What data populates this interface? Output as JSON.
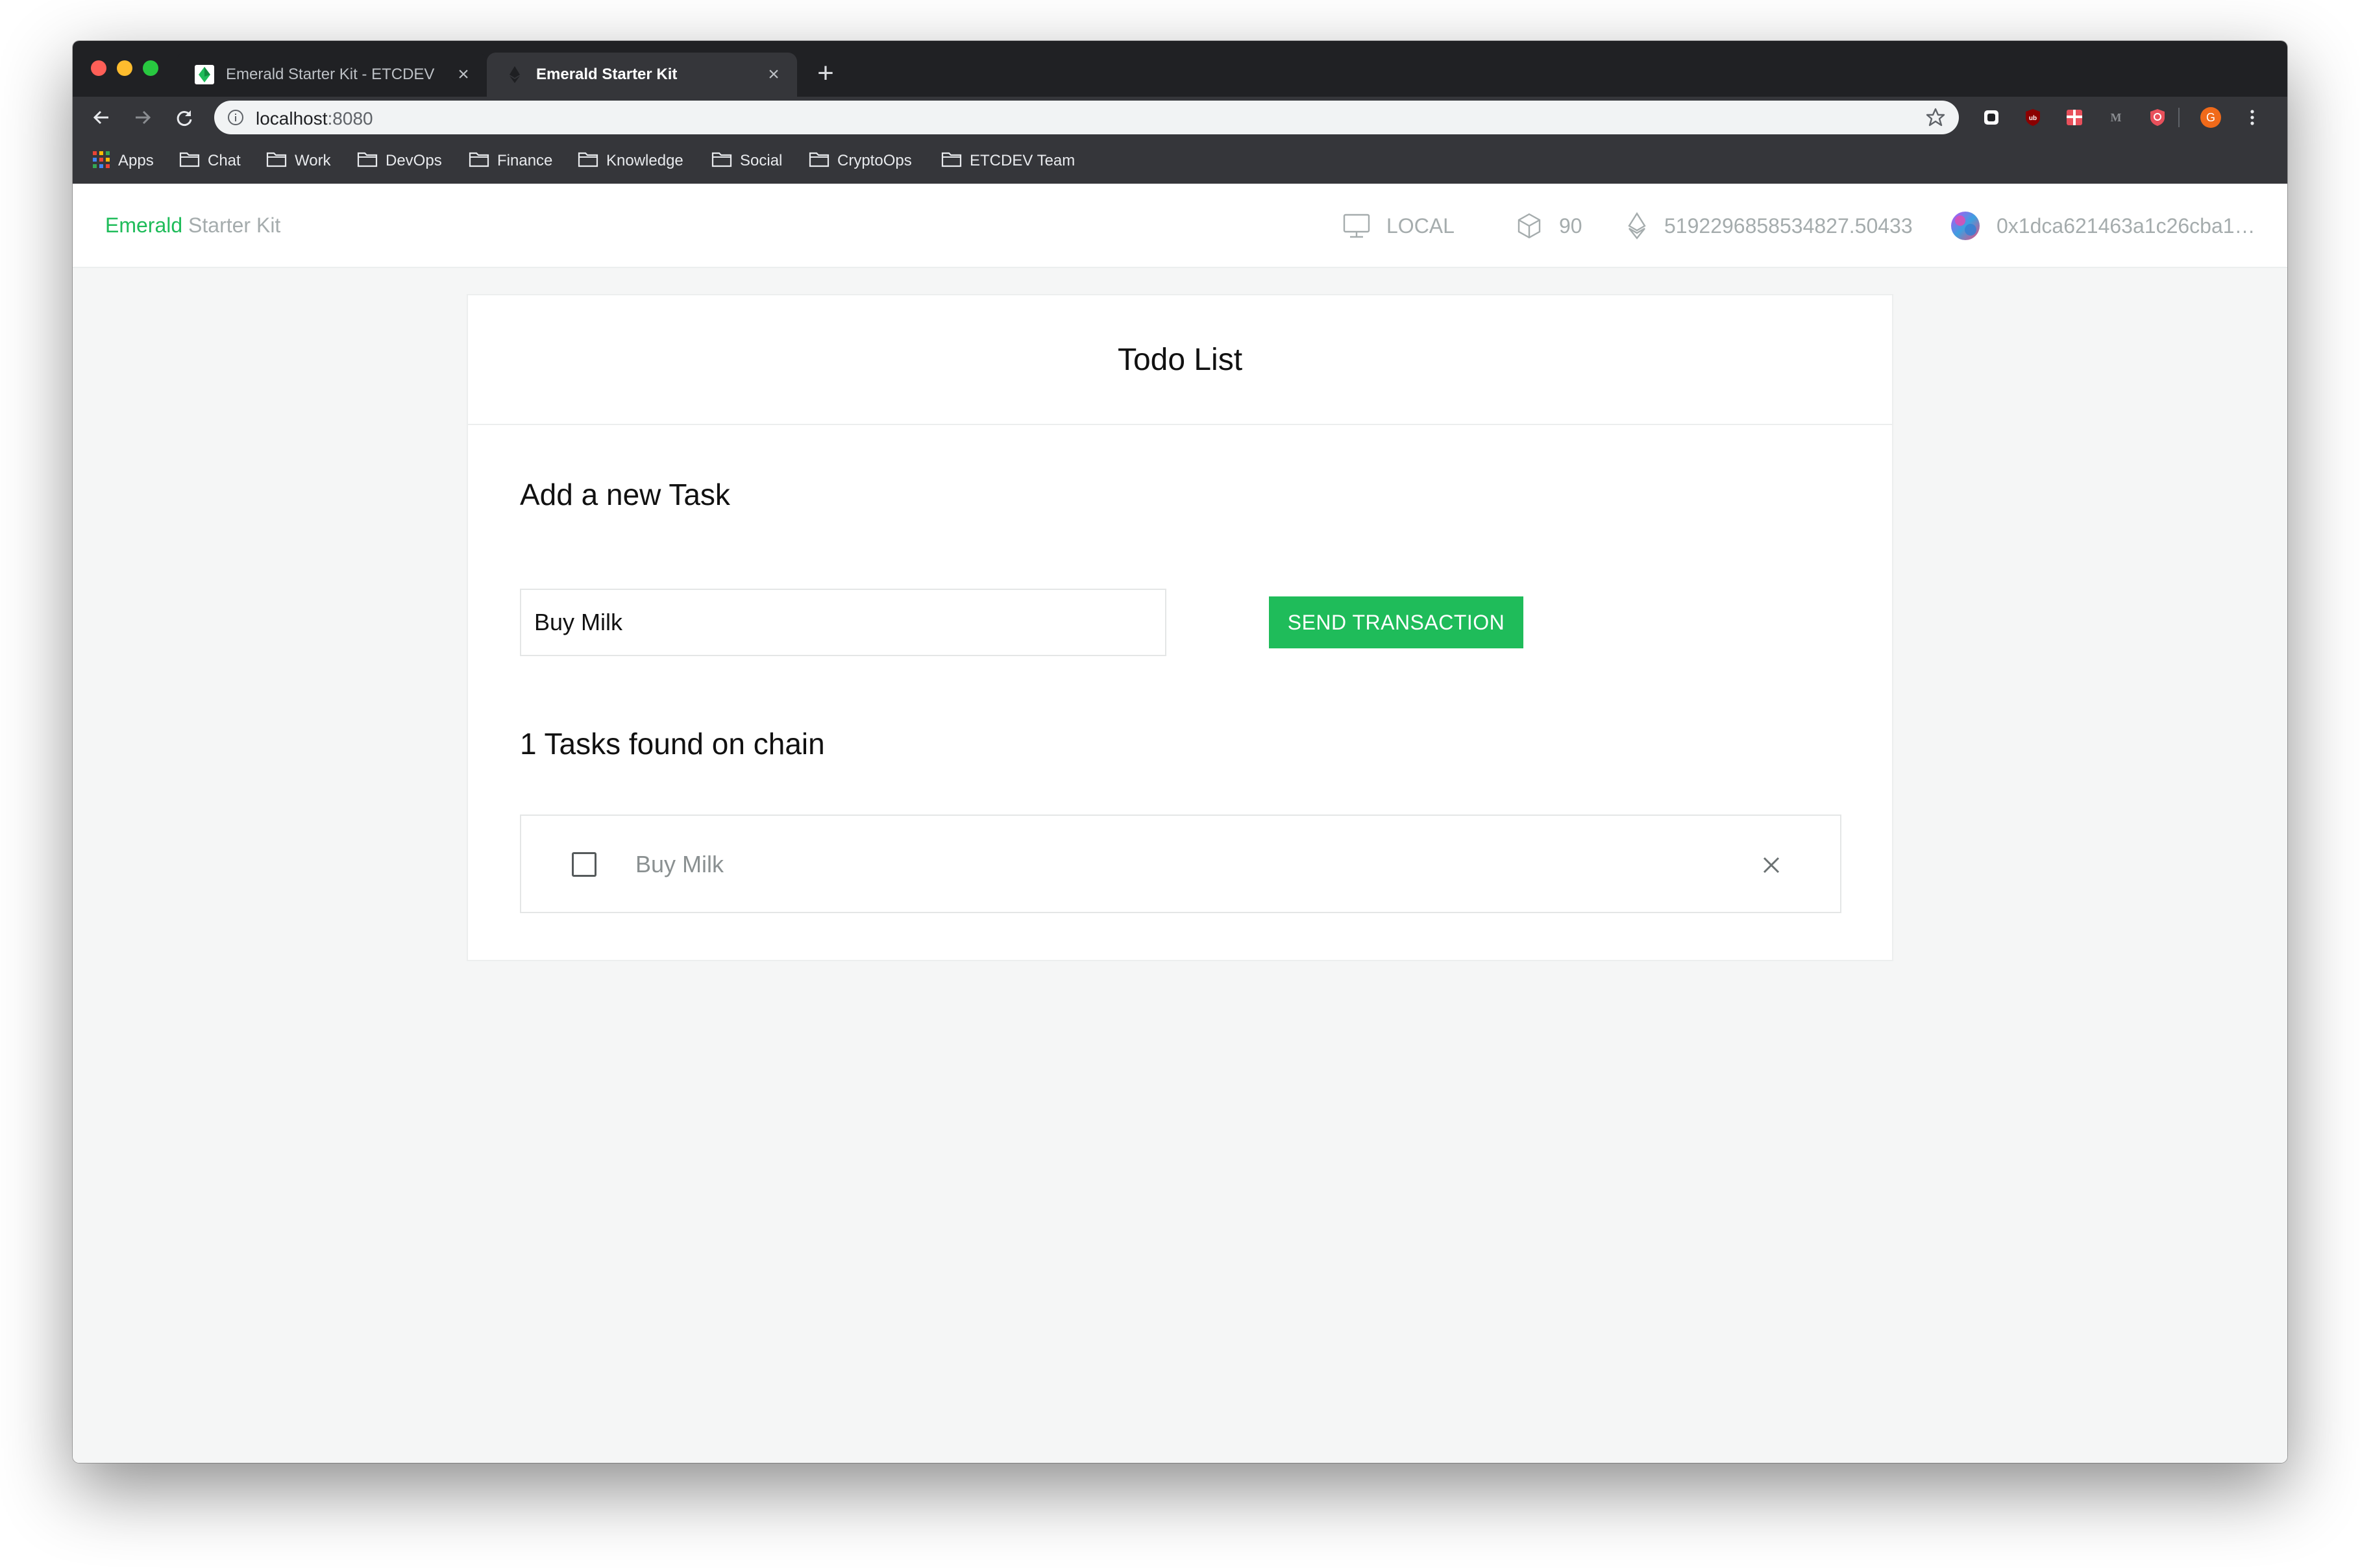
{
  "browser": {
    "tabs": [
      {
        "title": "Emerald Starter Kit - ETCDEV",
        "active": false
      },
      {
        "title": "Emerald Starter Kit",
        "active": true
      }
    ],
    "new_tab_symbol": "+",
    "tab_close_symbol": "×",
    "address": {
      "host": "localhost",
      "port": ":8080"
    },
    "bookmarks": [
      "Apps",
      "Chat",
      "Work",
      "DevOps",
      "Finance",
      "Knowledge",
      "Social",
      "CryptoOps",
      "ETCDEV Team"
    ],
    "profile_initial": "G",
    "extension_m_label": "M",
    "extension_ub_label": "ub"
  },
  "app": {
    "brand_primary": "Emerald",
    "brand_secondary": "Starter Kit",
    "network": "LOCAL",
    "block_number": "90",
    "balance": "5192296858534827.50433",
    "address": "0x1dca621463a1c26cba1…"
  },
  "todo": {
    "title": "Todo List",
    "add_heading": "Add a new Task",
    "input_value": "Buy Milk",
    "send_button": "SEND TRANSACTION",
    "found_heading": "1 Tasks found on chain",
    "tasks": [
      {
        "label": "Buy Milk",
        "done": false
      }
    ]
  },
  "colors": {
    "accent": "#1fbc5a",
    "muted": "#a5acad",
    "chrome_dark": "#202124",
    "chrome_toolbar": "#35363a"
  }
}
